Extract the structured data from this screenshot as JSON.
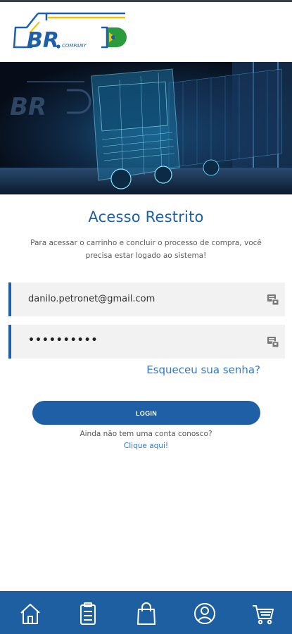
{
  "header": {
    "logo_text": "BR",
    "logo_sub": "COMPANY"
  },
  "hero": {
    "watermark": "BR"
  },
  "main": {
    "title": "Acesso Restrito",
    "subtitle": "Para acessar o carrinho e concluir o processo de compra, você precisa estar logado ao sistema!",
    "email_value": "danilo.petronet@gmail.com",
    "password_value": "••••••••••",
    "forgot_label": "Esqueceu sua senha?",
    "login_label": "LOGIN",
    "no_account_text": "Ainda não tem uma conta conosco?",
    "click_here_label": "Clique aqui!"
  },
  "colors": {
    "brand_blue": "#1d5fa8",
    "link_blue": "#2e78d2",
    "nav_bg": "#1d5fa1"
  },
  "bottom_nav": {
    "items": [
      "home-icon",
      "clipboard-icon",
      "shopping-bag-icon",
      "user-circle-icon",
      "cart-icon"
    ]
  }
}
